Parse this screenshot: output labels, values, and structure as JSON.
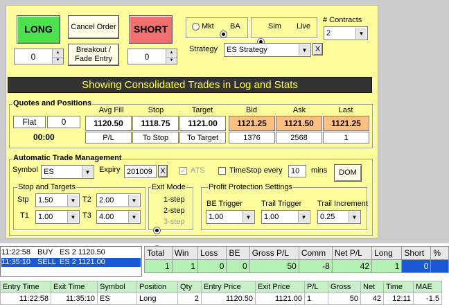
{
  "order": {
    "long_label": "LONG",
    "short_label": "SHORT",
    "cancel_label": "Cancel Order",
    "breakout_label": "Breakout / Fade Entry",
    "long_qty": "0",
    "short_qty": "0",
    "order_type": {
      "mkt": "Mkt",
      "ba": "BA",
      "selected": "BA"
    },
    "mode": {
      "sim": "Sim",
      "live": "Live",
      "selected": "Sim"
    },
    "contracts_label": "# Contracts",
    "contracts_value": "2",
    "strategy_label": "Strategy",
    "strategy_value": "ES Strategy",
    "strategy_clear": "X"
  },
  "banner": "Showing Consolidated Trades in Log and Stats",
  "quotes": {
    "title": "Quotes and Positions",
    "position": "Flat",
    "position_qty": "0",
    "time": "00:00",
    "headers": {
      "avg_fill": "Avg Fill",
      "stop": "Stop",
      "target": "Target",
      "bid": "Bid",
      "ask": "Ask",
      "last": "Last"
    },
    "avg_fill": "1120.50",
    "stop": "1118.75",
    "target": "1121.00",
    "bid": "1121.25",
    "ask": "1121.50",
    "last": "1121.25",
    "pl_label": "P/L",
    "to_stop": "To Stop",
    "to_target": "To Target",
    "bid_size": "1376",
    "ask_size": "2568",
    "last_size": "1"
  },
  "atm": {
    "title": "Automatic Trade Management",
    "symbol_label": "Symbol",
    "symbol_value": "ES",
    "expiry_label": "Expiry",
    "expiry_value": "201009",
    "expiry_clear": "X",
    "ats_label": "ATS",
    "timestop_label": "TimeStop every",
    "timestop_value": "10",
    "mins_label": "mins",
    "dom_label": "DOM",
    "stops_title": "Stop and Targets",
    "stp_label": "Stp",
    "stp_value": "1.50",
    "t1_label": "T1",
    "t1_value": "1.00",
    "t2_label": "T2",
    "t2_value": "2.00",
    "t3_label": "T3",
    "t3_value": "4.00",
    "exit_title": "Exit Mode",
    "exit_1": "1-step",
    "exit_2": "2-step",
    "exit_3": "3-step",
    "exit_selected": "1-step",
    "profit_title": "Profit Protection Settings",
    "be_label": "BE Trigger",
    "be_value": "1.00",
    "trail_trigger_label": "Trail Trigger",
    "trail_trigger_value": "1.00",
    "trail_inc_label": "Trail Increment",
    "trail_inc_value": "0.25"
  },
  "log": [
    {
      "time": "11:22:58",
      "side": "BUY",
      "desc": "ES 2 1120.50"
    },
    {
      "time": "11:35:10",
      "side": "SELL",
      "desc": "ES 2 1121.00"
    }
  ],
  "stats": {
    "headers": [
      "Total",
      "Win",
      "Loss",
      "BE",
      "Gross P/L",
      "Comm",
      "Net P/L",
      "Long",
      "Short",
      "%"
    ],
    "values": [
      "1",
      "1",
      "0",
      "0",
      "50",
      "-8",
      "42",
      "1",
      "0",
      ""
    ]
  },
  "trades": {
    "headers": [
      "Entry Time",
      "Exit Time",
      "Symbol",
      "Position",
      "Qty",
      "Entry Price",
      "Exit Price",
      "P/L",
      "Gross",
      "Net",
      "Time",
      "MAE"
    ],
    "rows": [
      [
        "11:22:58",
        "11:35:10",
        "ES",
        "Long",
        "2",
        "1120.50",
        "1121.00",
        "1",
        "50",
        "42",
        "12:11",
        "-1.5"
      ]
    ]
  },
  "colors": {
    "panel_bg": "#fdfd9e",
    "long_button": "#4fe04f",
    "short_button": "#f07070",
    "banner_bg": "#333333",
    "banner_text": "#ffff40",
    "quote_highlight": "#ffbf80",
    "stats_values_bg": "#b4f0b4",
    "selection": "#1a59d6"
  }
}
